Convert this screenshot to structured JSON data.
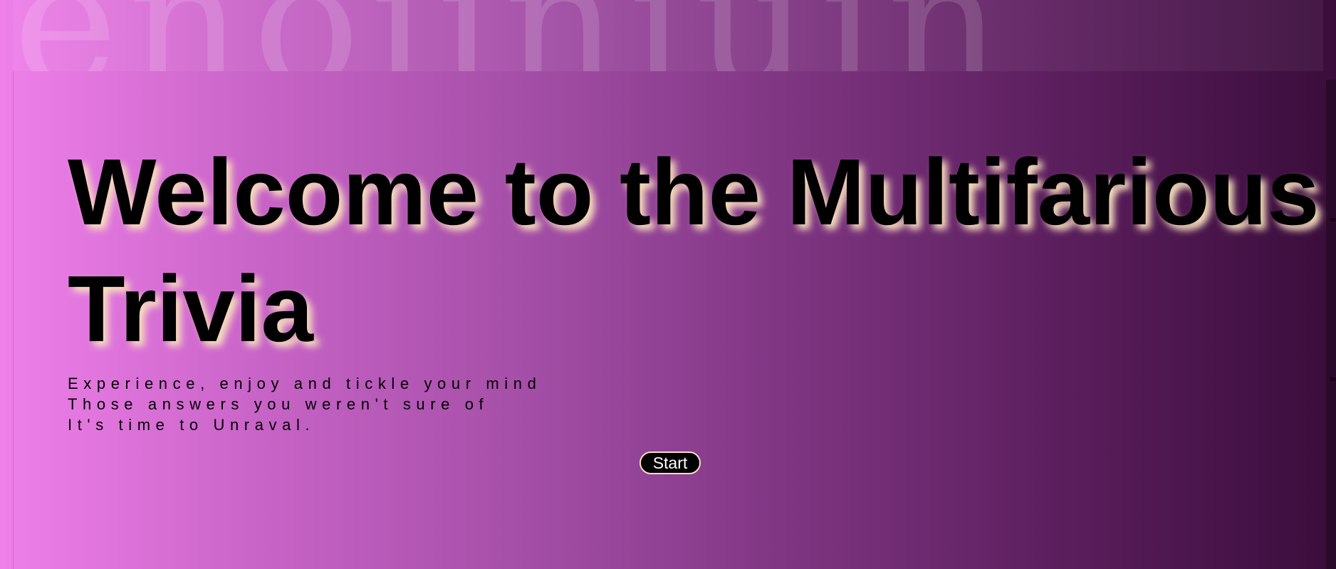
{
  "background": {
    "word": "enoiiniuin",
    "gradient_start": "#ef80ea",
    "gradient_end": "#3a0d3b"
  },
  "hero": {
    "title": "Welcome to the Multifarious Trivia",
    "title_shadow_color": "#f6dfbc"
  },
  "subtitle": {
    "lines": [
      "Experience, enjoy and tickle your mind",
      "Those answers you weren't sure of",
      "It's time to Unraval."
    ]
  },
  "actions": {
    "start_label": "Start"
  }
}
